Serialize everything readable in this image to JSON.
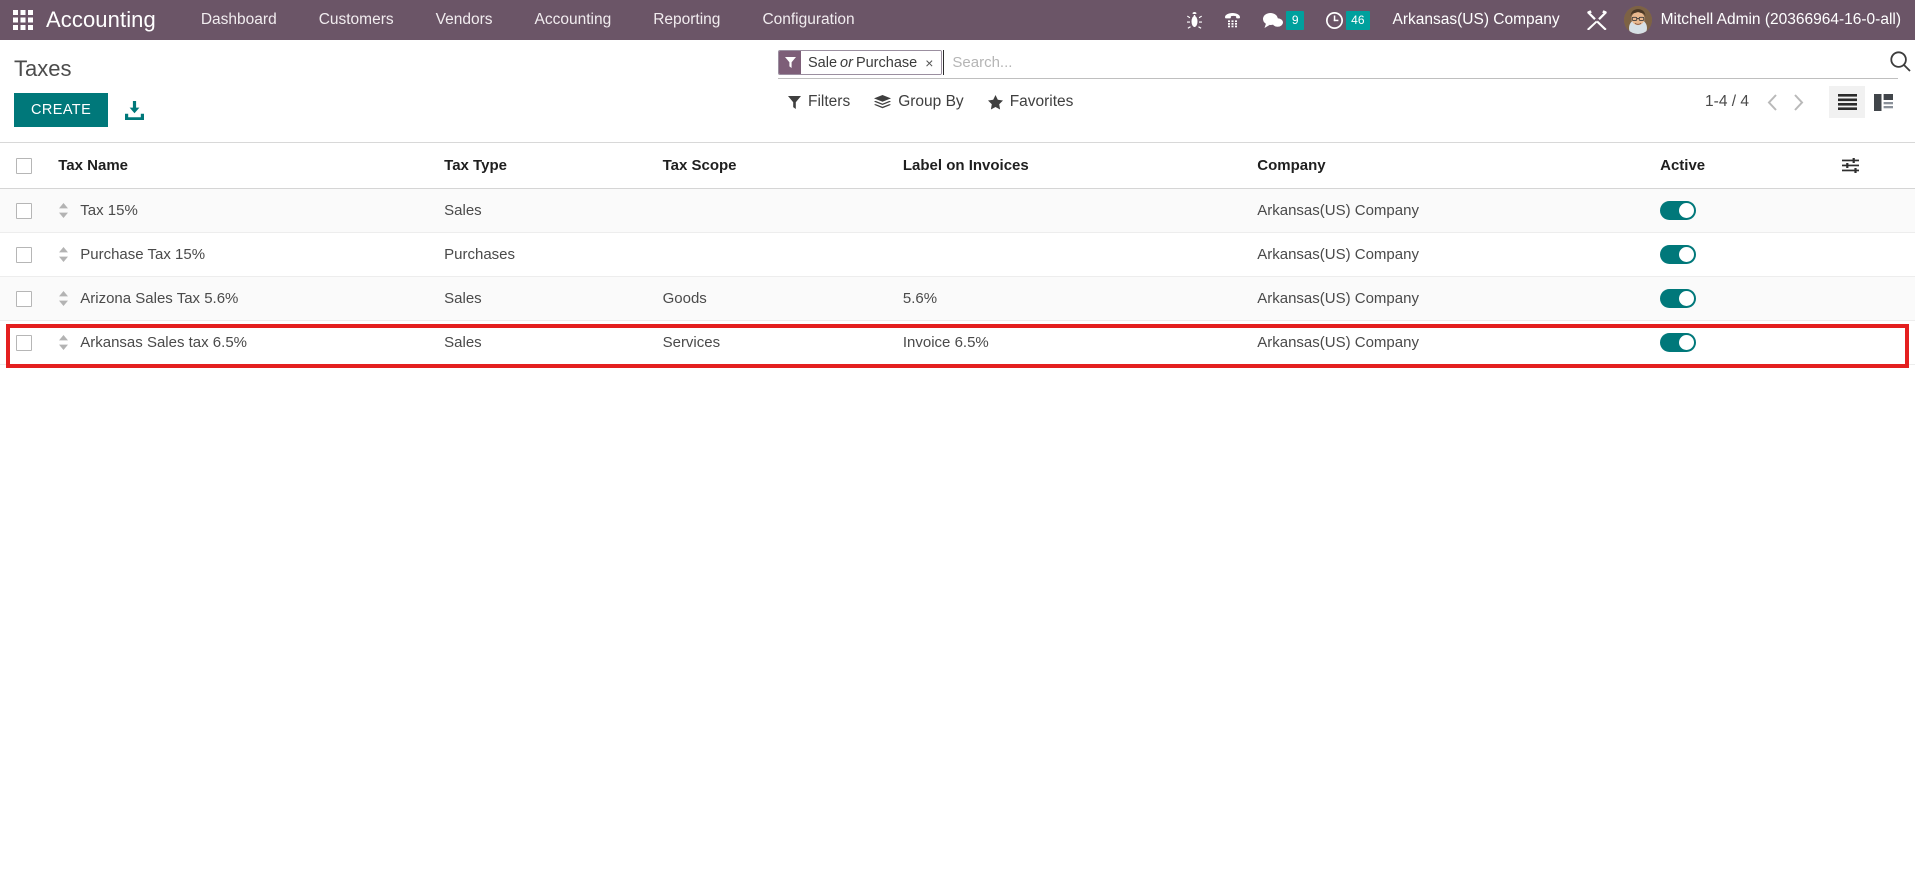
{
  "navbar": {
    "apps_icon": "apps-grid-icon",
    "brand": "Accounting",
    "menu_items": [
      {
        "label": "Dashboard"
      },
      {
        "label": "Customers"
      },
      {
        "label": "Vendors"
      },
      {
        "label": "Accounting"
      },
      {
        "label": "Reporting"
      },
      {
        "label": "Configuration"
      }
    ],
    "icons": [
      {
        "name": "bug-icon"
      },
      {
        "name": "dialpad-phone-icon"
      },
      {
        "name": "chat-bubble-icon",
        "badge": "9"
      },
      {
        "name": "clock-activity-icon",
        "badge": "46"
      }
    ],
    "company": "Arkansas(US) Company",
    "tools_icon": "tools-wrench-icon",
    "user_name": "Mitchell Admin (20366964-16-0-all)",
    "accent_color": "#6b5567",
    "badge_color": "#00a09d"
  },
  "control_panel": {
    "title": "Taxes",
    "create_label": "CREATE",
    "create_color": "#00787a",
    "import_icon": "import-download-icon",
    "search": {
      "facet": {
        "icon": "filter-funnel-icon",
        "text_before": "Sale",
        "text_italic": "or",
        "text_after": "Purchase",
        "remove": "×"
      },
      "placeholder": "Search...",
      "value": "",
      "magnifier_icon": "search-icon"
    },
    "filters_label": "Filters",
    "groupby_label": "Group By",
    "favorites_label": "Favorites",
    "pager": "1-4 / 4",
    "prev_icon": "chevron-left-icon",
    "next_icon": "chevron-right-icon",
    "views": [
      {
        "name": "list-view",
        "active": true
      },
      {
        "name": "kanban-view",
        "active": false
      }
    ]
  },
  "table": {
    "columns": [
      "Tax Name",
      "Tax Type",
      "Tax Scope",
      "Label on Invoices",
      "Company",
      "Active"
    ],
    "optional_columns_icon": "column-options-icon",
    "rows": [
      {
        "name": "Tax 15%",
        "type": "Sales",
        "scope": "",
        "label": "",
        "company": "Arkansas(US) Company",
        "active": true,
        "highlighted": false
      },
      {
        "name": "Purchase Tax 15%",
        "type": "Purchases",
        "scope": "",
        "label": "",
        "company": "Arkansas(US) Company",
        "active": true,
        "highlighted": false
      },
      {
        "name": "Arizona Sales Tax 5.6%",
        "type": "Sales",
        "scope": "Goods",
        "label": "5.6%",
        "company": "Arkansas(US) Company",
        "active": true,
        "highlighted": false
      },
      {
        "name": "Arkansas Sales tax 6.5%",
        "type": "Sales",
        "scope": "Services",
        "label": "Invoice 6.5%",
        "company": "Arkansas(US) Company",
        "active": true,
        "highlighted": true
      }
    ],
    "highlight_color": "#e41f1f"
  }
}
